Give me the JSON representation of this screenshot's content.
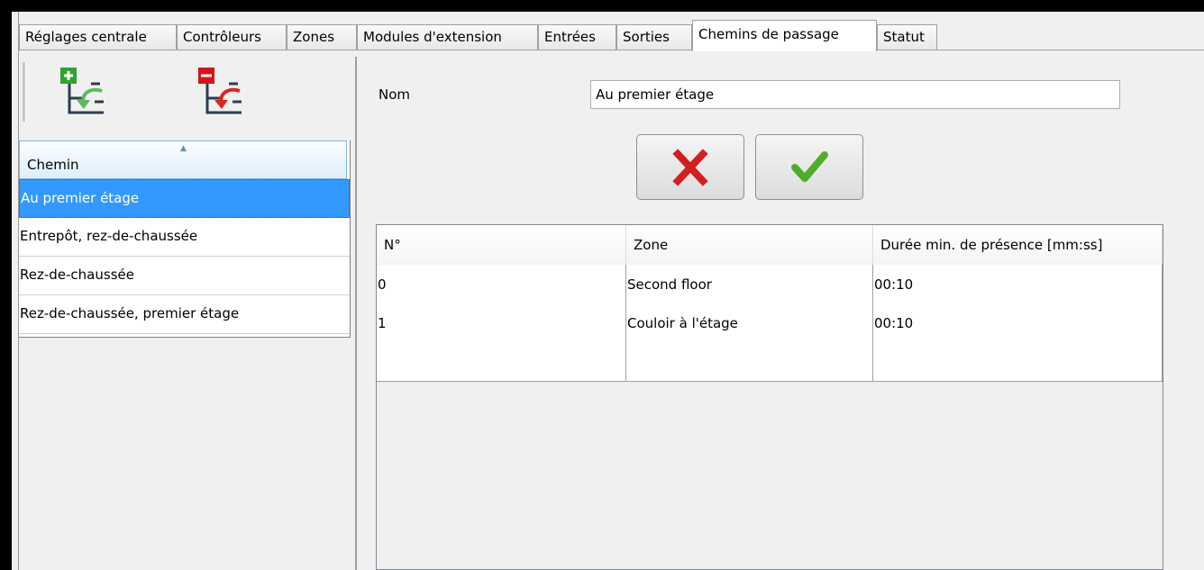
{
  "tabs": [
    {
      "label": "Réglages centrale",
      "active": false
    },
    {
      "label": "Contrôleurs",
      "active": false
    },
    {
      "label": "Zones",
      "active": false
    },
    {
      "label": "Modules d'extension",
      "active": false
    },
    {
      "label": "Entrées",
      "active": false
    },
    {
      "label": "Sorties",
      "active": false
    },
    {
      "label": "Chemins de passage",
      "active": true
    },
    {
      "label": "Statut",
      "active": false
    }
  ],
  "toolbar": {
    "add_icon": "add-path-icon",
    "remove_icon": "remove-path-icon"
  },
  "path_list": {
    "header": "Chemin",
    "items": [
      "Au premier étage",
      "Entrepôt, rez-de-chaussée",
      "Rez-de-chaussée",
      "Rez-de-chaussée, premier étage"
    ],
    "selected_index": 0
  },
  "editor": {
    "name_label": "Nom",
    "name_value": "Au premier étage",
    "cancel_icon": "cross-icon",
    "confirm_icon": "check-icon"
  },
  "grid": {
    "columns": [
      "N°",
      "Zone",
      "Durée min. de présence [mm:ss]"
    ],
    "rows": [
      [
        "0",
        "Second floor",
        "00:10"
      ],
      [
        "1",
        "Couloir à l'étage",
        "00:10"
      ],
      [
        "",
        "",
        ""
      ]
    ]
  },
  "colors": {
    "selection": "#3399ff",
    "cancel": "#d21f1f",
    "confirm": "#4cae2a",
    "add_badge": "#2fa32f",
    "remove_badge": "#d4141a"
  }
}
